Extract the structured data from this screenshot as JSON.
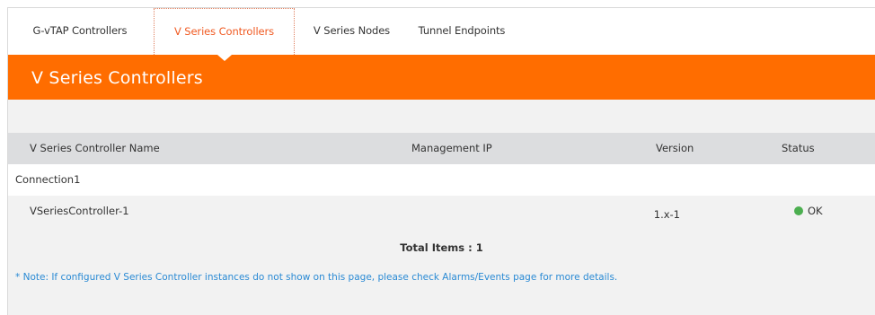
{
  "tabs": [
    {
      "label": "G-vTAP Controllers",
      "active": false
    },
    {
      "label": "V Series Controllers",
      "active": true
    },
    {
      "label": "V Series Nodes",
      "active": false
    },
    {
      "label": "Tunnel Endpoints",
      "active": false
    }
  ],
  "banner": {
    "title": "V Series Controllers",
    "color": "#ff6d00"
  },
  "table": {
    "columns": [
      "V Series Controller Name",
      "Management IP",
      "Version",
      "Status"
    ],
    "group": {
      "name": "Connection1"
    },
    "rows": [
      {
        "name": "VSeriesController-1",
        "management_ip": "",
        "version": "1.x-1",
        "status": "OK",
        "status_color": "#4caf50"
      }
    ],
    "total_label": "Total Items : 1"
  },
  "note": "* Note: If configured V Series Controller instances do not show on this page, please check Alarms/Events page for more details."
}
